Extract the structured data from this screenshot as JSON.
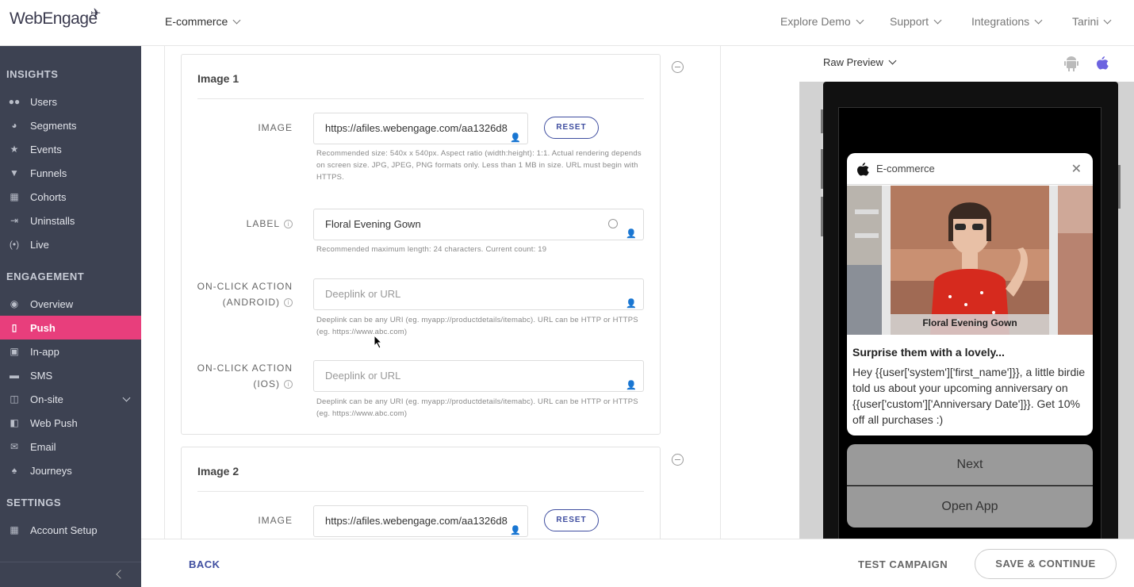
{
  "header": {
    "logo": "WebEngage",
    "project": "E-commerce",
    "nav": [
      "Explore Demo",
      "Support",
      "Integrations",
      "Tarini"
    ]
  },
  "sidebar": {
    "sections": [
      "INSIGHTS",
      "ENGAGEMENT",
      "SETTINGS"
    ],
    "insights": [
      {
        "label": "Users",
        "icon": "users-icon"
      },
      {
        "label": "Segments",
        "icon": "pie-icon"
      },
      {
        "label": "Events",
        "icon": "star-icon"
      },
      {
        "label": "Funnels",
        "icon": "funnel-icon"
      },
      {
        "label": "Cohorts",
        "icon": "grid-icon"
      },
      {
        "label": "Uninstalls",
        "icon": "exit-icon"
      },
      {
        "label": "Live",
        "icon": "broadcast-icon"
      }
    ],
    "engagement": [
      {
        "label": "Overview",
        "icon": "eye-icon"
      },
      {
        "label": "Push",
        "icon": "phone-icon"
      },
      {
        "label": "In-app",
        "icon": "inapp-icon"
      },
      {
        "label": "SMS",
        "icon": "chat-icon"
      },
      {
        "label": "On-site",
        "icon": "browser-icon"
      },
      {
        "label": "Web Push",
        "icon": "webpush-icon"
      },
      {
        "label": "Email",
        "icon": "mail-icon"
      },
      {
        "label": "Journeys",
        "icon": "rocket-icon"
      }
    ],
    "settings": [
      {
        "label": "Account Setup",
        "icon": "apps-icon"
      }
    ],
    "accent": "#e83e7c"
  },
  "image1": {
    "title": "Image 1",
    "image_label": "IMAGE",
    "image_url": "https://afiles.webengage.com/aa1326d8",
    "reset": "RESET",
    "image_help": "Recommended size: 540x x 540px. Aspect ratio (width:height): 1:1. Actual rendering depends on screen size. JPG, JPEG, PNG formats only. Less than 1 MB in size. URL must begin with HTTPS.",
    "label_label": "LABEL",
    "label_value": "Floral Evening Gown",
    "label_help": "Recommended maximum length: 24 characters. Current count: 19",
    "android_label_1": "ON-CLICK ACTION",
    "android_label_2": "(ANDROID)",
    "android_placeholder": "Deeplink or URL",
    "android_help": "Deeplink can be any URI (eg. myapp://productdetails/itemabc). URL can be HTTP or HTTPS (eg. https://www.abc.com)",
    "ios_label_1": "ON-CLICK ACTION",
    "ios_label_2": "(IOS)",
    "ios_placeholder": "Deeplink or URL",
    "ios_help": "Deeplink can be any URI (eg. myapp://productdetails/itemabc). URL can be HTTP or HTTPS (eg. https://www.abc.com)"
  },
  "image2": {
    "title": "Image 2",
    "image_label": "IMAGE",
    "image_url": "https://afiles.webengage.com/aa1326d8",
    "reset": "RESET"
  },
  "footer": {
    "back": "BACK",
    "test": "TEST CAMPAIGN",
    "save": "SAVE & CONTINUE"
  },
  "preview": {
    "mode": "Raw Preview",
    "app_name": "E-commerce",
    "image_caption": "Floral Evening Gown",
    "title": "Surprise them with a lovely...",
    "body": "Hey {{user['system']['first_name']}}, a little birdie told us about your upcoming anniversary on {{user['custom']['Anniversary Date']}}. Get 10% off all purchases :)",
    "button1": "Next",
    "button2": "Open App"
  }
}
